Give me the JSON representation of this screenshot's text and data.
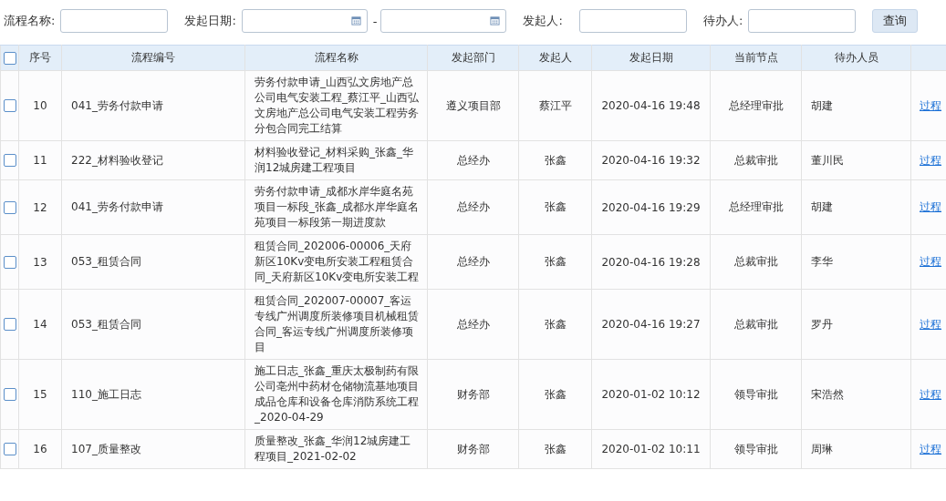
{
  "filters": {
    "fields": [
      {
        "label": "流程名称:",
        "kind": "text"
      },
      {
        "label": "发起日期:",
        "kind": "daterange",
        "separator": "-"
      },
      {
        "label": "发起人:",
        "kind": "text"
      },
      {
        "label": "待办人:",
        "kind": "text"
      }
    ],
    "button": "查询"
  },
  "table": {
    "select_all": {
      "checked": false
    },
    "columns": [
      "序号",
      "流程编号",
      "流程名称",
      "发起部门",
      "发起人",
      "发起日期",
      "当前节点",
      "待办人员"
    ],
    "rows": [
      {
        "checked": false,
        "no": "10",
        "code": "041_劳务付款申请",
        "name": "劳务付款申请_山西弘文房地产总公司电气安装工程_蔡江平_山西弘文房地产总公司电气安装工程劳务分包合同完工结算",
        "dept": "遵义项目部",
        "initiator": "蔡江平",
        "date": "2020-04-16 19:48",
        "node": "总经理审批",
        "pending": "胡建",
        "action": "过程"
      },
      {
        "checked": false,
        "no": "11",
        "code": "222_材料验收登记",
        "name": "材料验收登记_材料采购_张鑫_华润12城房建工程项目",
        "dept": "总经办",
        "initiator": "张鑫",
        "date": "2020-04-16 19:32",
        "node": "总裁审批",
        "pending": "董川民",
        "action": "过程"
      },
      {
        "checked": false,
        "no": "12",
        "code": "041_劳务付款申请",
        "name": "劳务付款申请_成都水岸华庭名苑项目一标段_张鑫_成都水岸华庭名苑项目一标段第一期进度款",
        "dept": "总经办",
        "initiator": "张鑫",
        "date": "2020-04-16 19:29",
        "node": "总经理审批",
        "pending": "胡建",
        "action": "过程"
      },
      {
        "checked": false,
        "no": "13",
        "code": "053_租赁合同",
        "name": "租赁合同_202006-00006_天府新区10Kv变电所安装工程租赁合同_天府新区10Kv变电所安装工程",
        "dept": "总经办",
        "initiator": "张鑫",
        "date": "2020-04-16 19:28",
        "node": "总裁审批",
        "pending": "李华",
        "action": "过程"
      },
      {
        "checked": false,
        "no": "14",
        "code": "053_租赁合同",
        "name": "租赁合同_202007-00007_客运专线广州调度所装修项目机械租赁合同_客运专线广州调度所装修项目",
        "dept": "总经办",
        "initiator": "张鑫",
        "date": "2020-04-16 19:27",
        "node": "总裁审批",
        "pending": "罗丹",
        "action": "过程"
      },
      {
        "checked": false,
        "no": "15",
        "code": "110_施工日志",
        "name": "施工日志_张鑫_重庆太极制药有限公司亳州中药材仓储物流基地项目成品仓库和设备仓库消防系统工程_2020-04-29",
        "dept": "财务部",
        "initiator": "张鑫",
        "date": "2020-01-02 10:12",
        "node": "领导审批",
        "pending": "宋浩然",
        "action": "过程"
      },
      {
        "checked": false,
        "no": "16",
        "code": "107_质量整改",
        "name": "质量整改_张鑫_华润12城房建工程项目_2021-02-02",
        "dept": "财务部",
        "initiator": "张鑫",
        "date": "2020-01-02 10:11",
        "node": "领导审批",
        "pending": "周琳",
        "action": "过程"
      }
    ]
  }
}
